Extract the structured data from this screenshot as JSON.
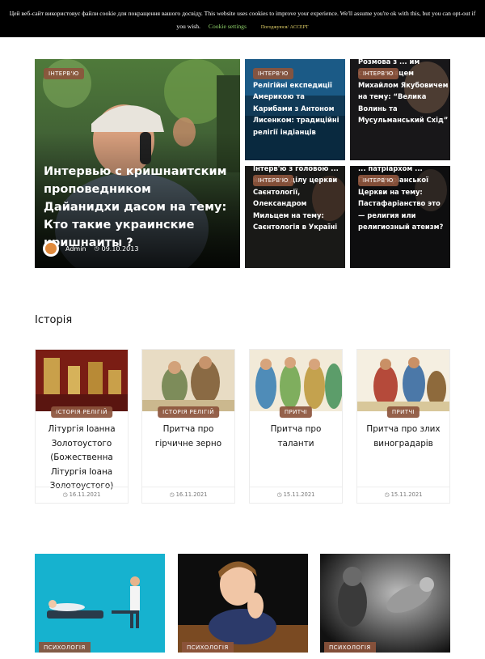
{
  "cookie": {
    "message": "Цей веб-сайт використовує файли cookie для покращення вашого досвіду. This website uses cookies to improve your experience. We'll assume you're ok with this, but you can opt-out if you wish.",
    "settings_label": "Cookie settings",
    "accept_label": "Погоджуюся/ ACCEPT"
  },
  "featured": {
    "main": {
      "tag": "Інтерв'ю",
      "title": "Интервью с кришнаитским проповедником Дайанидхи дасом на тему: Кто такие украинские кришнаиты ?",
      "author": "Admin",
      "date": "09.10.2013"
    },
    "items": [
      {
        "tag": "Інтерв'ю",
        "title": "Релігійні експедиції Америкою та Карибами з Антоном Лисенком: традиційні релігії індіанців"
      },
      {
        "tag": "Інтерв'ю",
        "title": "Розмова з ... им сходознавцем Михайлом Якубовичем на тему: “Велика Волинь та Мусульманський Схід”"
      },
      {
        "tag": "Інтерв'ю",
        "title": "Інтерв'ю з головою ... йного відділу церкви Саєнтології, Олександром Мильцем на тему: Саєнтологія в Україні"
      },
      {
        "tag": "Інтерв'ю",
        "title": "... патріархом ... Пастафаріанської Церкви на тему: Пастафаріанство это — религия или религиозный атеизм?"
      }
    ]
  },
  "history": {
    "heading": "Історія",
    "cards": [
      {
        "tag": "Історія релігій",
        "title": "Літургія Іоанна Золотоустого (Божественна Літургія Іоана Золотоустого)",
        "date": "16.11.2021"
      },
      {
        "tag": "Історія релігій",
        "title": "Притча про гірчичне зерно",
        "date": "16.11.2021"
      },
      {
        "tag": "Притчі",
        "title": "Притча про таланти",
        "date": "15.11.2021"
      },
      {
        "tag": "Притчі",
        "title": "Притча про злих виноградарів",
        "date": "15.11.2021"
      }
    ]
  },
  "psychology": {
    "cards": [
      {
        "tag": "Психологія"
      },
      {
        "tag": "Психологія"
      },
      {
        "tag": "Психологія"
      }
    ]
  },
  "icons": {
    "clock": "clock-icon",
    "avatar": "author-avatar-icon"
  },
  "colors": {
    "tag_bg": "#8c543c",
    "cookie_bg": "#000000",
    "cookie_settings": "#8fd16a",
    "cookie_accept": "#e4d36a"
  }
}
